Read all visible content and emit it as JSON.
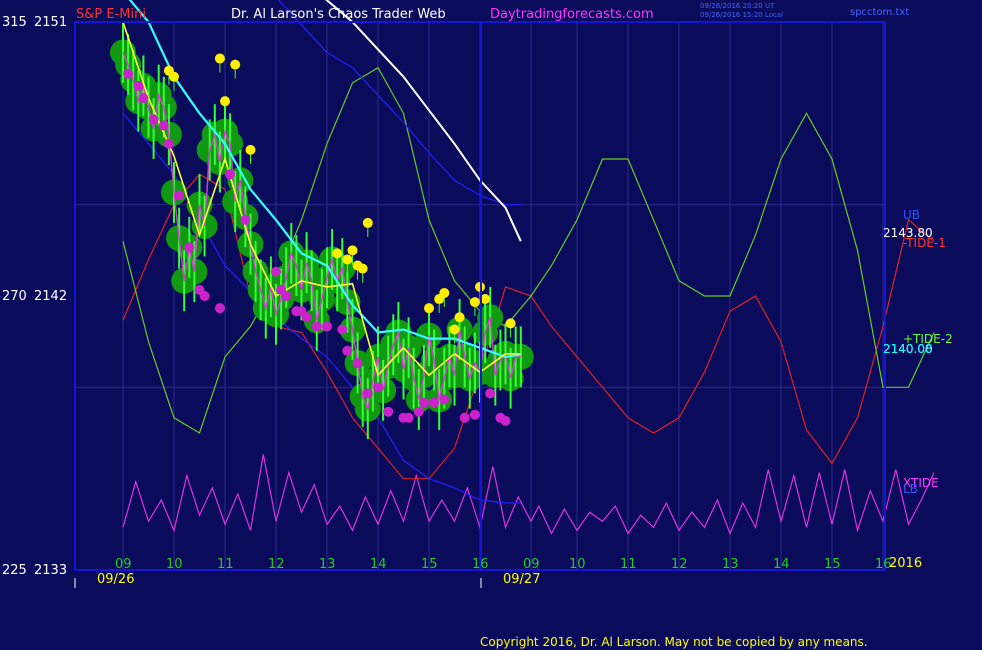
{
  "header": {
    "instrument": "S&P E-Mini",
    "publisher": "Dr. Al Larson's Chaos Trader Web",
    "website": "Daytradingforecasts.com",
    "timestamp_1": "09/26/2016 20:20 UT",
    "timestamp_2": "09/26/2016 15:20 Local",
    "file_name": "spcctom.txt"
  },
  "footer": {
    "copyright": "Copyright 2016, Dr. Al Larson. May not be copied by any means."
  },
  "colors": {
    "background": "#0b0b5c",
    "frame": "#1515d8",
    "grid": "#2b2b8a",
    "axis_text": "#ffff00",
    "price_text": "#ffffff",
    "hour_labels": "#22cc22",
    "date_labels": "#ffff00",
    "copyright": "#ffff00",
    "title_instrument": "#ff3333",
    "title_publisher": "#ffffff",
    "title_website": "#ff33ff",
    "timestamp": "#4466ff",
    "filename": "#4466ff"
  },
  "chart_data": {
    "type": "line",
    "title": "S&P E-Mini",
    "y_axis_left": {
      "ticks": [
        {
          "angle": "315",
          "price": "2151"
        },
        {
          "angle": "270",
          "price": "2142"
        },
        {
          "angle": "225",
          "price": "2133"
        }
      ],
      "ylim": [
        2133,
        2151
      ]
    },
    "x_axis": {
      "hour_labels": [
        "09",
        "10",
        "11",
        "12",
        "13",
        "14",
        "15",
        "16",
        "09",
        "10",
        "11",
        "12",
        "13",
        "14",
        "15",
        "16"
      ],
      "date_labels": [
        "09/26",
        "09/27"
      ],
      "year_label": "2016"
    },
    "right_labels": [
      {
        "text": "UB",
        "color": "#3355ff"
      },
      {
        "text": "2143.80",
        "color": "#ffffff"
      },
      {
        "text": "-TIDE-1",
        "color": "#ff3333"
      },
      {
        "text": "+TIDE-2",
        "color": "#66ff33"
      },
      {
        "text": "2140.00",
        "color": "#ffffff"
      },
      {
        "text": "2140.08",
        "color": "#00ffff"
      },
      {
        "text": "XTIDE",
        "color": "#ff33ff"
      },
      {
        "text": "LB",
        "color": "#3355ff"
      }
    ],
    "last_prices": {
      "upper_band_marker": 2143.8,
      "close": 2140.0,
      "average": 2140.08
    },
    "series": [
      {
        "name": "price",
        "color": "#22dd22",
        "glow_color": "#119911",
        "x": [
          0.0,
          0.1,
          0.2,
          0.3,
          0.4,
          0.5,
          0.6,
          0.7,
          0.8,
          0.9,
          1.0,
          1.1,
          1.2,
          1.3,
          1.4,
          1.5,
          1.6,
          1.7,
          1.8,
          1.9,
          2.0,
          2.1,
          2.2,
          2.3,
          2.4,
          2.5,
          2.6,
          2.7,
          2.8,
          2.9,
          3.0,
          3.1,
          3.2,
          3.3,
          3.4,
          3.5,
          3.6,
          3.7,
          3.8,
          3.9,
          4.0,
          4.1,
          4.2,
          4.3,
          4.4,
          4.5,
          4.6,
          4.7,
          4.8,
          4.9,
          5.0,
          5.1,
          5.2,
          5.3,
          5.4,
          5.5,
          5.6,
          5.7,
          5.8,
          5.9,
          6.0,
          6.1,
          6.2,
          6.3,
          6.4,
          6.5,
          6.6,
          6.7,
          6.8,
          6.9,
          7.0,
          7.1,
          7.2,
          7.3,
          7.4,
          7.5,
          7.6,
          7.7,
          7.8
        ],
        "values": [
          2150.0,
          2149.6,
          2149.1,
          2148.4,
          2148.9,
          2148.2,
          2147.5,
          2148.6,
          2148.2,
          2147.3,
          2145.4,
          2143.9,
          2142.5,
          2143.6,
          2142.8,
          2145.0,
          2144.3,
          2146.8,
          2147.3,
          2146.4,
          2147.4,
          2147.0,
          2145.1,
          2145.8,
          2144.6,
          2143.7,
          2142.8,
          2142.2,
          2141.6,
          2142.3,
          2141.4,
          2141.9,
          2142.6,
          2143.4,
          2143.0,
          2142.2,
          2143.1,
          2142.5,
          2141.2,
          2141.9,
          2142.6,
          2143.2,
          2142.5,
          2142.9,
          2141.8,
          2140.9,
          2139.8,
          2138.7,
          2138.3,
          2139.2,
          2140.0,
          2138.9,
          2139.7,
          2140.4,
          2140.8,
          2139.6,
          2140.3,
          2139.3,
          2138.6,
          2139.4,
          2140.7,
          2139.9,
          2138.6,
          2139.3,
          2140.0,
          2139.4,
          2140.9,
          2140.0,
          2139.3,
          2139.8,
          2139.5,
          2140.8,
          2141.3,
          2139.4,
          2139.9,
          2140.1,
          2139.3,
          2140.0,
          2140.0
        ]
      },
      {
        "name": "fast_average",
        "color": "#ffff33",
        "x": [
          0.0,
          0.5,
          1.0,
          1.5,
          2.0,
          2.5,
          3.0,
          3.5,
          4.0,
          4.5,
          5.0,
          5.5,
          6.0,
          6.5,
          7.0,
          7.5,
          7.8
        ],
        "values": [
          2151.0,
          2148.5,
          2146.6,
          2144.0,
          2146.5,
          2143.7,
          2142.0,
          2142.5,
          2142.3,
          2142.4,
          2139.4,
          2140.3,
          2139.4,
          2140.1,
          2139.5,
          2140.1,
          2140.1
        ]
      },
      {
        "name": "medium_average",
        "color": "#33ffff",
        "x": [
          0.0,
          0.5,
          1.0,
          1.5,
          2.0,
          2.5,
          3.0,
          3.5,
          4.0,
          4.5,
          5.0,
          5.5,
          6.0,
          6.5,
          7.0,
          7.5,
          7.8
        ],
        "values": [
          2152.0,
          2151.0,
          2149.2,
          2148.0,
          2147.0,
          2145.5,
          2144.5,
          2143.4,
          2143.0,
          2141.7,
          2140.8,
          2140.9,
          2140.6,
          2140.6,
          2140.3,
          2140.0,
          2140.08
        ]
      },
      {
        "name": "slow_average",
        "color": "#ffffff",
        "x": [
          3.8,
          4.5,
          5.0,
          5.5,
          6.0,
          6.5,
          7.0,
          7.5,
          7.8
        ],
        "values": [
          2152.0,
          2151.0,
          2150.1,
          2149.2,
          2148.1,
          2147.0,
          2145.8,
          2144.9,
          2143.8
        ]
      },
      {
        "name": "UB",
        "color": "#2222ff",
        "x": [
          2.9,
          3.5,
          4.0,
          4.5,
          5.0,
          5.5,
          6.0,
          6.5,
          7.0,
          7.5,
          7.8
        ],
        "values": [
          2152.0,
          2150.9,
          2150.0,
          2149.5,
          2148.6,
          2147.7,
          2146.7,
          2145.8,
          2145.3,
          2145.0,
          2145.0
        ]
      },
      {
        "name": "LB",
        "color": "#2222ff",
        "x": [
          0.0,
          1.0,
          2.0,
          3.0,
          3.5,
          4.0,
          4.5,
          5.0,
          5.5,
          6.0,
          6.5,
          7.0,
          7.5,
          7.8
        ],
        "values": [
          2148.0,
          2146.0,
          2143.0,
          2141.3,
          2140.6,
          2140.0,
          2139.0,
          2138.0,
          2136.6,
          2136.0,
          2135.7,
          2135.3,
          2135.2,
          2135.2
        ]
      },
      {
        "name": "-TIDE-1",
        "color": "#dd2222",
        "x": [
          0.0,
          0.5,
          1.0,
          1.5,
          2.0,
          2.5,
          3.0,
          3.5,
          4.0,
          4.5,
          5.0,
          5.5,
          6.0,
          6.5,
          7.0,
          7.5,
          8.0,
          8.5,
          9.0,
          9.5,
          10.0,
          10.5,
          11.0,
          11.5,
          12.0,
          12.5,
          13.0,
          13.5,
          14.0,
          14.5,
          15.0,
          15.5,
          16.0
        ],
        "values": [
          2141.2,
          2143.2,
          2145.0,
          2146.0,
          2145.5,
          2142.0,
          2141.0,
          2140.8,
          2139.5,
          2138.0,
          2137.0,
          2136.0,
          2136.0,
          2137.0,
          2139.5,
          2142.3,
          2142.0,
          2141.0,
          2140.0,
          2139.0,
          2138.0,
          2137.5,
          2138.0,
          2139.5,
          2141.5,
          2142.0,
          2140.5,
          2137.6,
          2136.5,
          2138.0,
          2141.0,
          2144.5,
          2143.8
        ]
      },
      {
        "name": "+TIDE-2",
        "color": "#66cc22",
        "x": [
          0.0,
          0.5,
          1.0,
          1.5,
          2.0,
          2.5,
          3.0,
          3.5,
          4.0,
          4.5,
          5.0,
          5.5,
          6.0,
          6.5,
          7.0,
          7.5,
          8.0,
          8.5,
          9.0,
          9.5,
          10.0,
          10.5,
          11.0,
          11.5,
          12.0,
          12.5,
          13.0,
          13.5,
          14.0,
          14.5,
          15.0,
          15.5,
          16.0
        ],
        "values": [
          2143.8,
          2140.5,
          2138.0,
          2137.5,
          2140.0,
          2141.0,
          2142.5,
          2144.5,
          2147.0,
          2149.0,
          2149.5,
          2148.0,
          2144.5,
          2142.5,
          2141.5,
          2141.0,
          2142.0,
          2143.0,
          2144.5,
          2146.5,
          2146.5,
          2144.5,
          2142.5,
          2142.0,
          2142.0,
          2144.0,
          2146.5,
          2148.0,
          2146.5,
          2143.5,
          2139.0,
          2139.0,
          2140.8
        ]
      },
      {
        "name": "XTIDE",
        "color": "#dd33dd",
        "x": [
          0.0,
          0.25,
          0.5,
          0.75,
          1.0,
          1.25,
          1.5,
          1.75,
          2.0,
          2.25,
          2.5,
          2.75,
          3.0,
          3.25,
          3.5,
          3.75,
          4.0,
          4.25,
          4.5,
          4.75,
          5.0,
          5.25,
          5.5,
          5.75,
          6.0,
          6.25,
          6.5,
          6.75,
          7.0,
          7.25,
          7.5,
          7.75,
          8.0,
          8.25,
          8.5,
          8.75,
          9.0,
          9.25,
          9.5,
          9.75,
          10.0,
          10.25,
          10.5,
          10.75,
          11.0,
          11.25,
          11.5,
          11.75,
          12.0,
          12.25,
          12.5,
          12.75,
          13.0,
          13.25,
          13.5,
          13.75,
          14.0,
          14.25,
          14.5,
          14.75,
          15.0,
          15.25,
          15.5,
          15.75,
          16.0
        ],
        "values": [
          2134.4,
          2135.9,
          2134.6,
          2135.3,
          2134.3,
          2136.1,
          2134.8,
          2135.7,
          2134.5,
          2135.5,
          2134.3,
          2136.8,
          2134.6,
          2136.2,
          2134.9,
          2135.8,
          2134.5,
          2135.1,
          2134.3,
          2135.4,
          2134.5,
          2135.6,
          2134.6,
          2136.1,
          2134.6,
          2135.3,
          2134.6,
          2135.7,
          2134.4,
          2136.4,
          2134.4,
          2135.4,
          2134.6,
          2135.1,
          2134.2,
          2135.0,
          2134.3,
          2134.9,
          2134.6,
          2135.1,
          2134.2,
          2134.8,
          2134.4,
          2135.2,
          2134.3,
          2134.9,
          2134.4,
          2135.3,
          2134.2,
          2135.2,
          2134.4,
          2136.3,
          2134.6,
          2136.1,
          2134.4,
          2136.2,
          2134.5,
          2136.3,
          2134.3,
          2135.6,
          2134.6,
          2136.3,
          2134.5,
          2135.3,
          2136.2
        ]
      }
    ],
    "highs": {
      "name": "high markers",
      "color": "#ffee00",
      "x": [
        0.9,
        1.0,
        1.9,
        2.0,
        2.2,
        2.5,
        4.2,
        4.4,
        4.5,
        4.6,
        4.7,
        4.8,
        6.0,
        6.2,
        6.3,
        6.5,
        6.6,
        6.9,
        7.0,
        7.1,
        7.6
      ],
      "values": [
        2149.4,
        2149.2,
        2149.8,
        2148.4,
        2149.6,
        2146.8,
        2143.4,
        2143.2,
        2143.5,
        2143.0,
        2142.9,
        2144.4,
        2141.6,
        2141.9,
        2142.1,
        2140.9,
        2141.3,
        2141.8,
        2142.3,
        2141.9,
        2141.1
      ]
    },
    "lows": {
      "name": "low markers",
      "color": "#cc22cc",
      "x": [
        0.1,
        0.3,
        0.4,
        0.6,
        0.8,
        0.9,
        1.1,
        1.3,
        1.5,
        1.6,
        1.9,
        2.1,
        2.4,
        3.0,
        3.1,
        3.2,
        3.4,
        3.5,
        3.6,
        3.8,
        4.0,
        4.3,
        4.4,
        4.6,
        4.8,
        5.0,
        5.2,
        5.5,
        5.6,
        5.8,
        5.9,
        6.1,
        6.3,
        6.7,
        6.9,
        7.2,
        7.4,
        7.5
      ],
      "values": [
        2149.3,
        2148.9,
        2148.5,
        2147.8,
        2147.6,
        2147.0,
        2145.3,
        2143.6,
        2142.2,
        2142.0,
        2141.6,
        2146.0,
        2144.5,
        2142.8,
        2142.2,
        2142.0,
        2141.5,
        2141.5,
        2141.3,
        2141.0,
        2141.0,
        2140.9,
        2140.2,
        2139.8,
        2138.8,
        2139.0,
        2138.2,
        2138.0,
        2138.0,
        2138.2,
        2138.5,
        2138.5,
        2138.6,
        2138.0,
        2138.1,
        2138.8,
        2138.0,
        2137.9
      ]
    }
  }
}
